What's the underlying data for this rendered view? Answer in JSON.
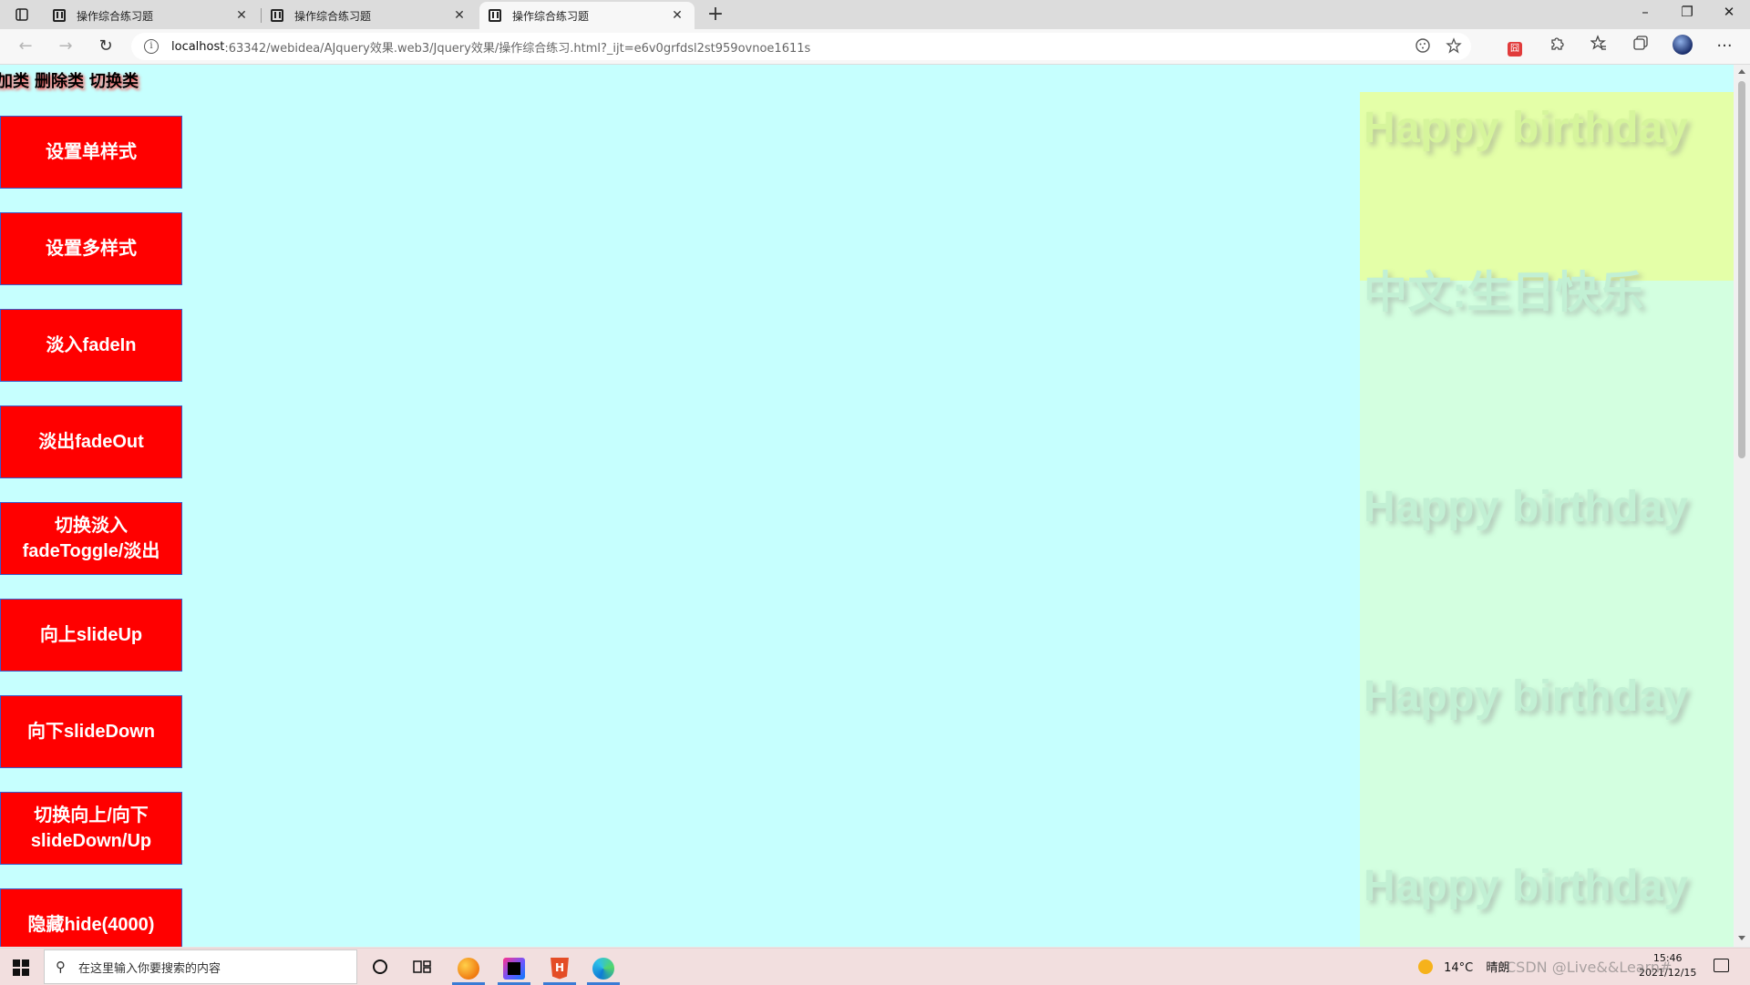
{
  "browser": {
    "tabs": [
      {
        "title": "操作综合练习题",
        "active": false
      },
      {
        "title": "操作综合练习题",
        "active": false
      },
      {
        "title": "操作综合练习题",
        "active": true
      }
    ],
    "new_tab_glyph": "+",
    "window_controls": {
      "minimize": "–",
      "restore": "❐",
      "close": "✕"
    },
    "url": {
      "host": "localhost",
      "rest": ":63342/webidea/AJquery效果.web3/Jquery效果/操作综合练习.html?_ijt=e6v0grfdsl2st959ovnoe1611s"
    },
    "toolbar_glyphs": {
      "back": "←",
      "forward": "→",
      "refresh": "↻",
      "info": "i",
      "more": "···"
    },
    "icons": [
      "back-arrow-icon",
      "forward-arrow-icon",
      "refresh-icon",
      "site-info-icon",
      "reader-icon",
      "add-favorite-icon",
      "extension-icon",
      "puzzle-icon",
      "favorites-icon",
      "collections-icon",
      "profile-avatar-icon",
      "more-icon"
    ]
  },
  "page": {
    "class_links": [
      "加类",
      "删除类",
      "切换类"
    ],
    "buttons": [
      {
        "label": "设置单样式"
      },
      {
        "label": "设置多样式"
      },
      {
        "label": "淡入fadeIn"
      },
      {
        "label": "淡出fadeOut"
      },
      {
        "label": "切换淡入\nfadeToggle/淡出"
      },
      {
        "label": "向上slideUp"
      },
      {
        "label": "向下slideDown"
      },
      {
        "label": "切换向上/向下\nslideDown/Up"
      },
      {
        "label": "隐藏hide(4000)"
      }
    ],
    "birthday": {
      "heading_top": "Happy birthday",
      "chinese": "中文:生日快乐",
      "repeats": [
        "Happy birthday",
        "Happy birthday",
        "Happy birthday"
      ]
    },
    "colors": {
      "background": "#c6fffe",
      "button_bg": "#ff0000",
      "button_text": "#ffffff",
      "panel_top": "#e4ffa8",
      "panel": "#d3ffe0"
    }
  },
  "taskbar": {
    "search_placeholder": "在这里输入你要搜索的内容",
    "weather_temp": "14°C",
    "weather_text": "晴朗",
    "time": "15:46",
    "date": "2021/12/15",
    "watermark": "CSDN @Live&&Learn#"
  }
}
